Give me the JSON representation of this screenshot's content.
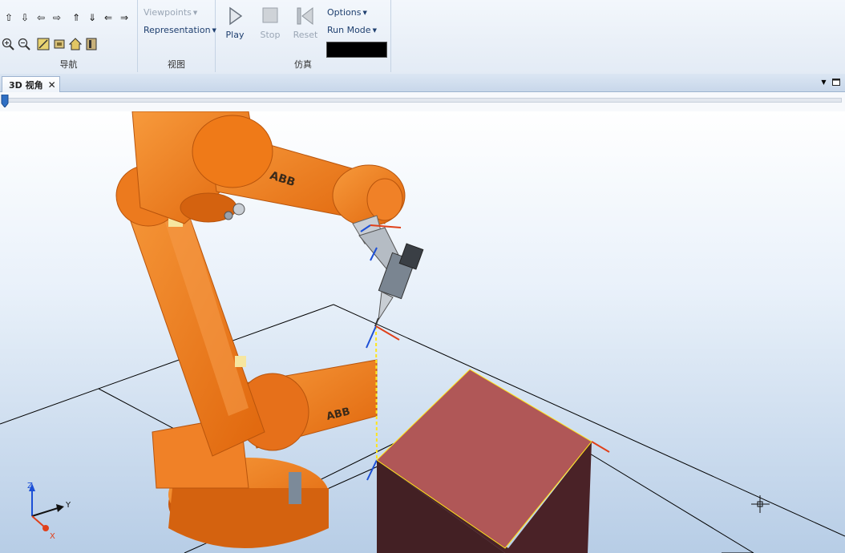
{
  "ribbon": {
    "nav_group": {
      "label": "导航",
      "row1_icons": [
        "pan-up-bold-icon",
        "pan-down-bold-icon",
        "pan-left-bold-icon",
        "pan-right-bold-icon",
        "arrow-up-icon",
        "arrow-down-icon",
        "arrow-left-icon",
        "arrow-right-icon"
      ],
      "row2_icons": [
        "zoom-in-icon",
        "zoom-out-icon",
        "zoom-window-icon",
        "view-all-icon",
        "home-view-icon",
        "frame-view-icon"
      ]
    },
    "view_group": {
      "label": "视图",
      "viewpoints": "Viewpoints",
      "representation": "Representation"
    },
    "sim_group": {
      "label": "仿真",
      "play": "Play",
      "stop": "Stop",
      "reset": "Reset",
      "options": "Options",
      "run_mode": "Run Mode",
      "time_display": ""
    }
  },
  "tab": {
    "label": "3D 视角",
    "close": "✕"
  },
  "timeline": {
    "position": 0
  },
  "viewport": {
    "brand_label": "ABB",
    "axes": {
      "z": "Z",
      "y": "Y",
      "x": "X"
    },
    "colors": {
      "robot": "#ef7a18",
      "robot_dark": "#b8540c",
      "box_top": "#b05757",
      "box_side": "#4a2227",
      "path": "#ffe51a"
    }
  }
}
